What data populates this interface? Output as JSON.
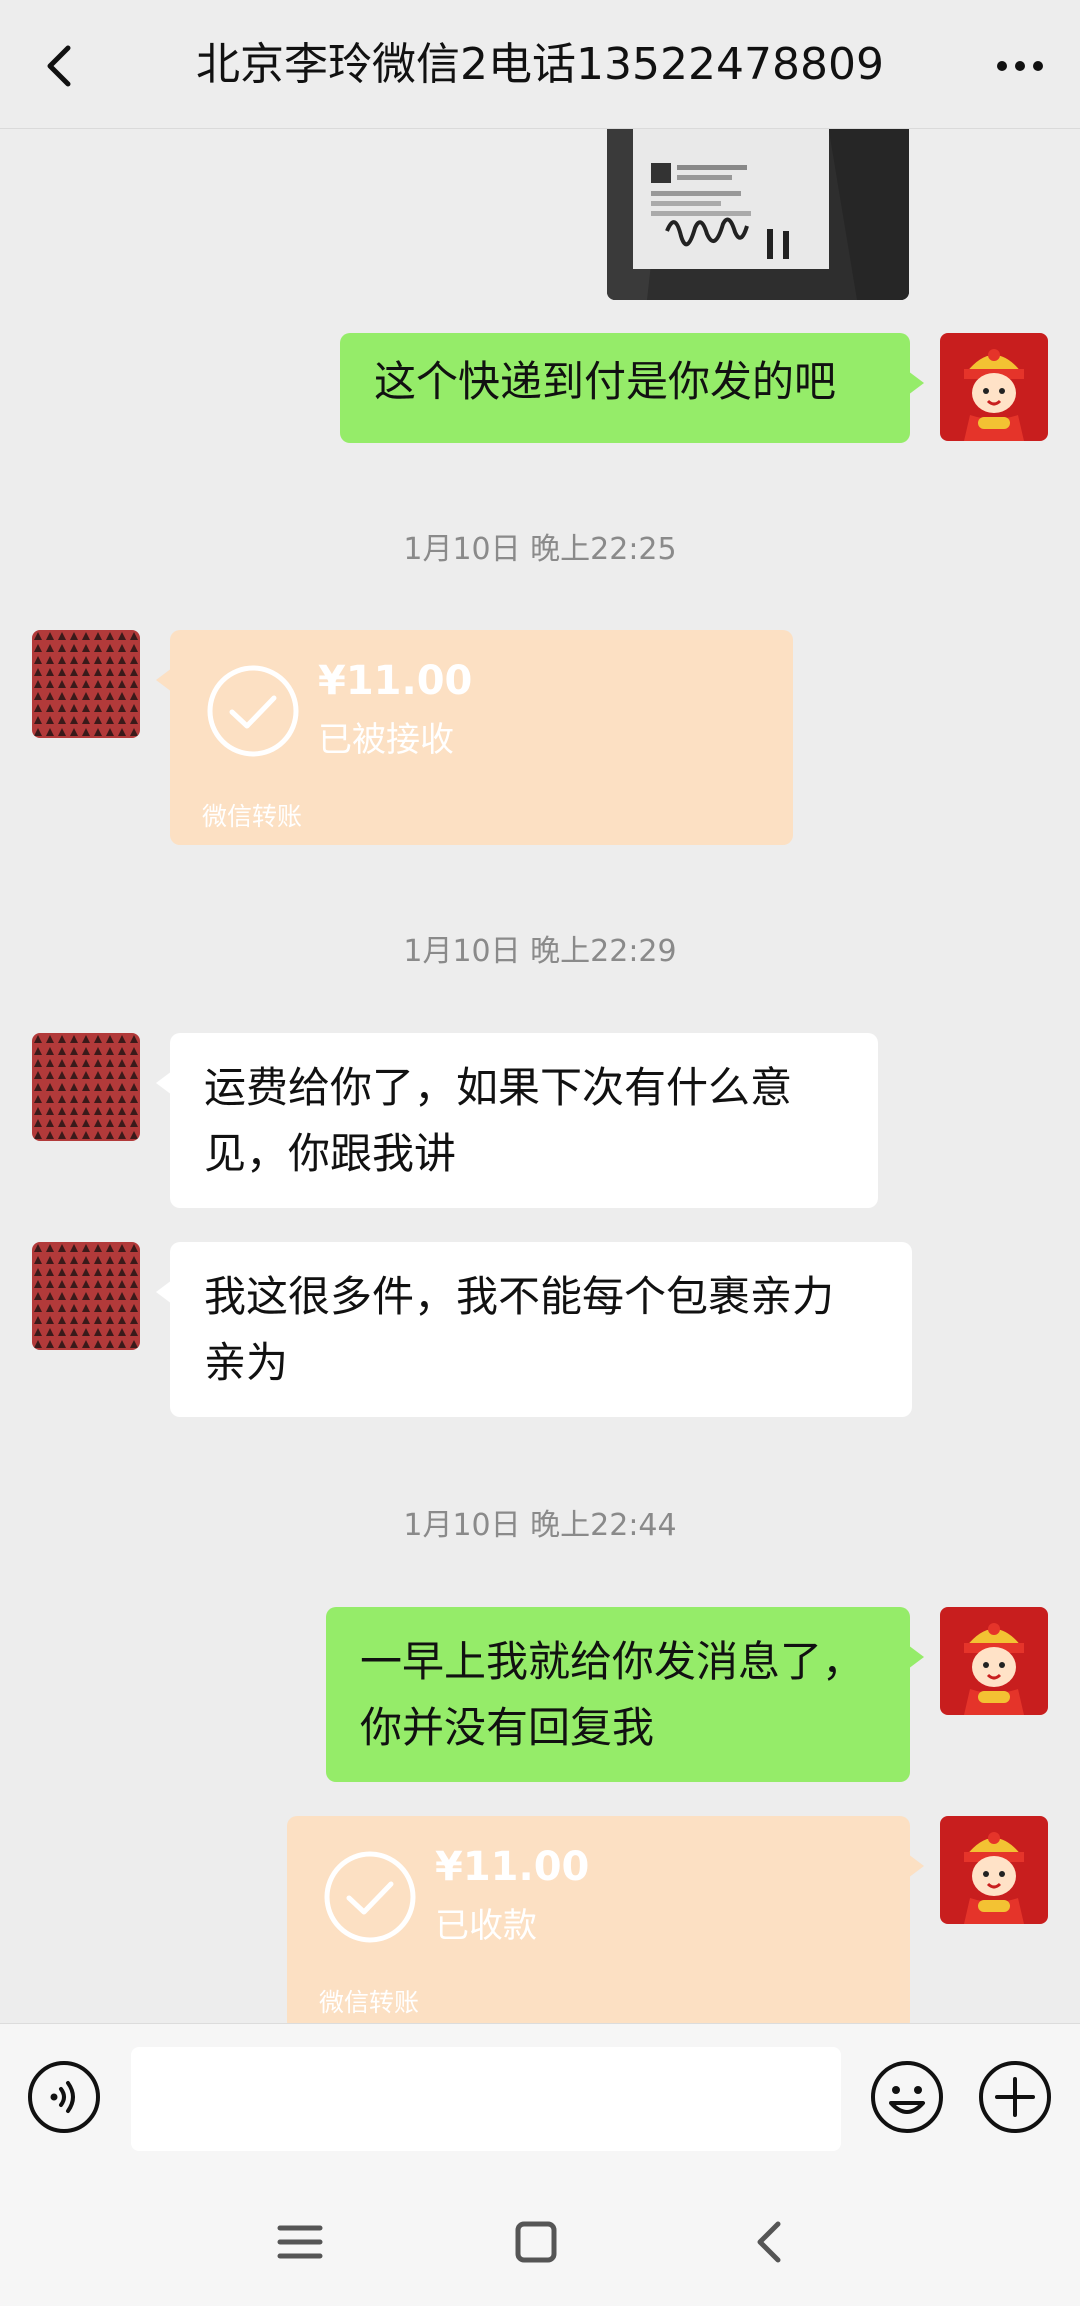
{
  "header": {
    "title": "北京李玲微信2电话13522478809",
    "back_icon": "chevron-left-icon",
    "more_icon": "more-horizontal-icon"
  },
  "colors": {
    "background": "#ededed",
    "my_bubble": "#95ec69",
    "their_bubble": "#ffffff",
    "transfer_card": "#fce0c3",
    "timestamp": "#8a8a8a"
  },
  "messages": {
    "m1": {
      "sender": "me",
      "type": "image"
    },
    "m2": {
      "sender": "me",
      "type": "text",
      "text": "这个快递到付是你发的吧"
    },
    "ts1": "1月10日 晚上22:25",
    "m3": {
      "sender": "them",
      "type": "transfer",
      "amount": "¥11.00",
      "status": "已被接收",
      "label": "微信转账"
    },
    "ts2": "1月10日 晚上22:29",
    "m4": {
      "sender": "them",
      "type": "text",
      "line1": "运费给你了，如果下次有什么意",
      "line2": "见，你跟我讲"
    },
    "m5": {
      "sender": "them",
      "type": "text",
      "line1": "我这很多件，我不能每个包裹亲力",
      "line2": "亲为"
    },
    "ts3": "1月10日 晚上22:44",
    "m6": {
      "sender": "me",
      "type": "text",
      "line1": "一早上我就给你发消息了，",
      "line2": "你并没有回复我"
    },
    "m7": {
      "sender": "me",
      "type": "transfer",
      "amount": "¥11.00",
      "status": "已收款",
      "label": "微信转账"
    }
  },
  "input_bar": {
    "voice_icon": "voice-icon",
    "text_value": "",
    "emoji_icon": "emoji-icon",
    "plus_icon": "plus-circle-icon"
  },
  "nav_bar": {
    "menu_icon": "menu-icon",
    "home_icon": "home-square-icon",
    "back_icon": "back-triangle-icon"
  }
}
